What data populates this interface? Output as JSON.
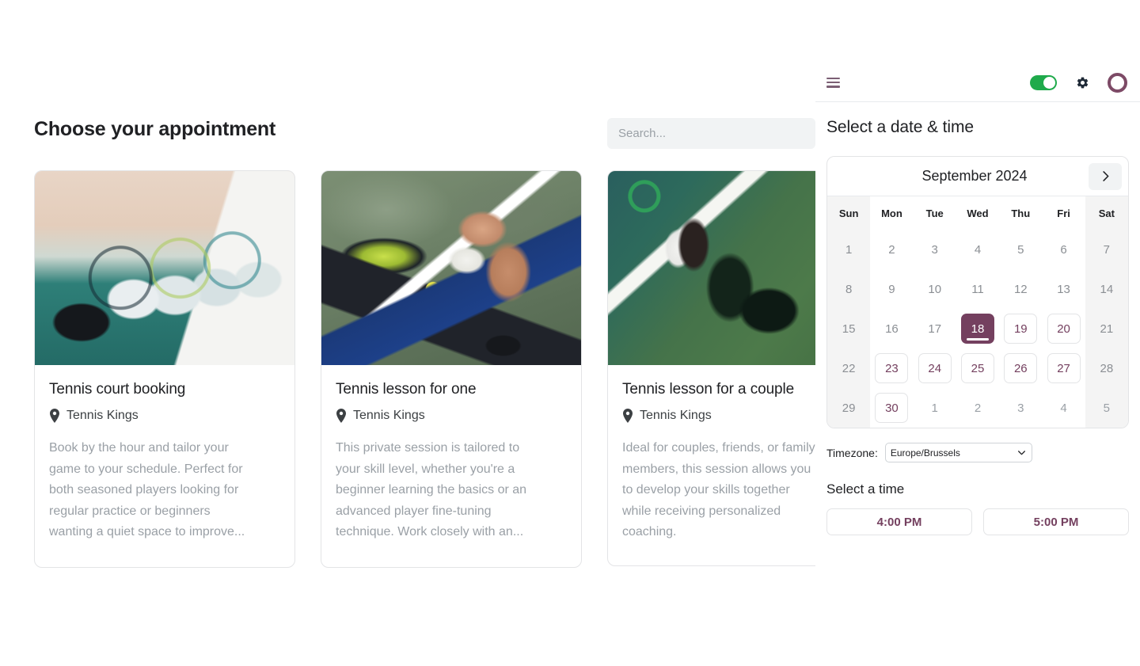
{
  "left": {
    "page_title": "Choose your appointment",
    "search": {
      "placeholder": "Search...",
      "value": ""
    },
    "cards": [
      {
        "title": "Tennis court booking",
        "location": "Tennis Kings",
        "description": "Book by the hour and tailor your\ngame to your schedule. Perfect for\nboth seasoned players looking for\nregular practice or beginners\nwanting a quiet space to improve...",
        "photo": "tennis-players-on-bench-with-rackets"
      },
      {
        "title": "Tennis lesson for one",
        "location": "Tennis Kings",
        "description": "This private session is tailored to\nyour skill level, whether you're a\nbeginner learning the basics or an\nadvanced player fine-tuning\ntechnique. Work closely with an...",
        "photo": "player-kneeling-with-racket-and-balls"
      },
      {
        "title": "Tennis lesson for a couple",
        "location": "Tennis Kings",
        "description": "Ideal for couples, friends, or family\nmembers, this session allows you\nto develop your skills together\nwhile receiving personalized\ncoaching.",
        "photo": "overhead-player-hitting-backhand"
      }
    ]
  },
  "panel": {
    "header": {
      "menu_icon": "hamburger-icon",
      "toggle_state": "on",
      "settings_icon": "gear-icon",
      "avatar_icon": "avatar-ring"
    },
    "title": "Select a date & time",
    "calendar": {
      "month_label": "September 2024",
      "next_icon": "chevron-right-icon",
      "weekdays": [
        "Sun",
        "Mon",
        "Tue",
        "Wed",
        "Thu",
        "Fri",
        "Sat"
      ],
      "weeks": [
        [
          {
            "label": "1",
            "state": "muted"
          },
          {
            "label": "2",
            "state": "muted"
          },
          {
            "label": "3",
            "state": "muted"
          },
          {
            "label": "4",
            "state": "muted"
          },
          {
            "label": "5",
            "state": "muted"
          },
          {
            "label": "6",
            "state": "muted"
          },
          {
            "label": "7",
            "state": "muted"
          }
        ],
        [
          {
            "label": "8",
            "state": "muted"
          },
          {
            "label": "9",
            "state": "muted"
          },
          {
            "label": "10",
            "state": "muted"
          },
          {
            "label": "11",
            "state": "muted"
          },
          {
            "label": "12",
            "state": "muted"
          },
          {
            "label": "13",
            "state": "muted"
          },
          {
            "label": "14",
            "state": "muted"
          }
        ],
        [
          {
            "label": "15",
            "state": "muted"
          },
          {
            "label": "16",
            "state": "muted"
          },
          {
            "label": "17",
            "state": "muted"
          },
          {
            "label": "18",
            "state": "selected"
          },
          {
            "label": "19",
            "state": "available"
          },
          {
            "label": "20",
            "state": "available"
          },
          {
            "label": "21",
            "state": "muted"
          }
        ],
        [
          {
            "label": "22",
            "state": "muted"
          },
          {
            "label": "23",
            "state": "available"
          },
          {
            "label": "24",
            "state": "available"
          },
          {
            "label": "25",
            "state": "available"
          },
          {
            "label": "26",
            "state": "available"
          },
          {
            "label": "27",
            "state": "available"
          },
          {
            "label": "28",
            "state": "muted"
          }
        ],
        [
          {
            "label": "29",
            "state": "muted"
          },
          {
            "label": "30",
            "state": "available"
          },
          {
            "label": "1",
            "state": "out"
          },
          {
            "label": "2",
            "state": "out"
          },
          {
            "label": "3",
            "state": "out"
          },
          {
            "label": "4",
            "state": "out"
          },
          {
            "label": "5",
            "state": "out"
          }
        ]
      ]
    },
    "timezone": {
      "label": "Timezone:",
      "selected": "Europe/Brussels",
      "chevron_icon": "chevron-down-icon"
    },
    "time": {
      "title": "Select a time",
      "slots": [
        "4:00 PM",
        "5:00 PM"
      ]
    }
  },
  "colors": {
    "accent_purple": "#74405f",
    "toggle_green": "#1faa4b",
    "avatar_ring": "#7d4a66",
    "muted_text": "#9aa0a6",
    "border": "#e3e4e6"
  }
}
